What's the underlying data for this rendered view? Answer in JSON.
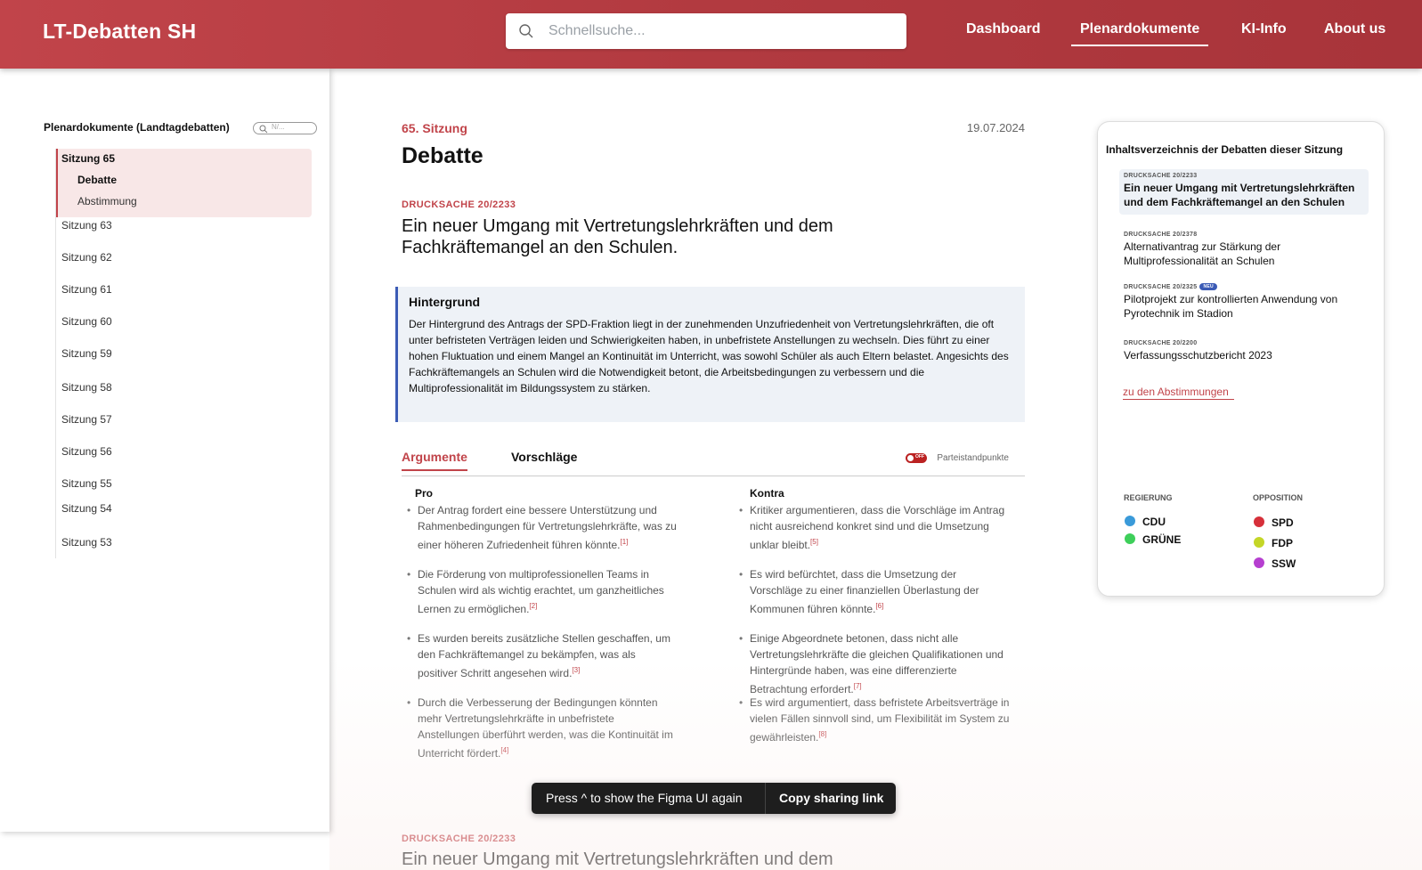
{
  "header": {
    "logo": "LT-Debatten SH",
    "search_placeholder": "Schnellsuche...",
    "nav": [
      "Dashboard",
      "Plenardokumente",
      "KI-Info",
      "About us"
    ],
    "active_nav": "Plenardokumente"
  },
  "sidebar": {
    "title": "Plenardokumente (Landtagdebatten)",
    "filter_placeholder": "N/...",
    "active_session": "Sitzung 65",
    "sub_items": [
      "Debatte",
      "Abstimmung"
    ],
    "sessions": [
      "Sitzung 63",
      "Sitzung 62",
      "Sitzung 61",
      "Sitzung 60",
      "Sitzung 59",
      "Sitzung 58",
      "Sitzung 57",
      "Sitzung 56",
      "Sitzung 55",
      "Sitzung 54",
      "Sitzung 53"
    ]
  },
  "main": {
    "sitzung": "65. Sitzung",
    "date": "19.07.2024",
    "title": "Debatte",
    "drucksache_label": "DRUCKSACHE 20/2233",
    "drucksache_title": "Ein neuer Umgang mit Vertretungslehrkräften und dem Fachkräftemangel an den Schulen.",
    "background": {
      "heading": "Hintergrund",
      "text": "Der Hintergrund des Antrags der SPD-Fraktion liegt in der zunehmenden  Unzufriedenheit von Vertretungslehrkräften, die oft unter befristeten  Verträgen leiden und Schwierigkeiten haben, in unbefristete Anstellungen  zu wechseln. Dies führt zu einer hohen Fluktuation und einem Mangel an  Kontinuität im Unterricht, was sowohl Schüler als auch Eltern belastet.  Angesichts des Fachkräftemangels an Schulen wird die Notwendigkeit  betont, die Arbeitsbedingungen zu verbessern und die  Multiprofessionalität im Bildungssystem zu stärken."
    },
    "tabs": [
      "Argumente",
      "Vorschläge"
    ],
    "toggle_state": "OFF",
    "toggle_label": "Parteistandpunkte",
    "pro_heading": "Pro",
    "kontra_heading": "Kontra",
    "pro": [
      {
        "text": "Der Antrag fordert eine bessere Unterstützung und Rahmenbedingungen für  Vertretungslehrkräfte, was zu einer höheren Zufriedenheit führen könnte.",
        "ref": "[1]"
      },
      {
        "text": "Die Förderung von multiprofessionellen Teams in Schulen wird als wichtig erachtet, um ganzheitliches Lernen zu ermöglichen.",
        "ref": "[2]"
      },
      {
        "text": "Es wurden bereits zusätzliche Stellen geschaffen, um den  Fachkräftemangel zu bekämpfen, was als positiver Schritt angesehen wird.",
        "ref": "[3]"
      },
      {
        "text": "Durch die Verbesserung der Bedingungen könnten mehr  Vertretungslehrkräfte in unbefristete Anstellungen überführt werden, was  die Kontinuität im Unterricht fördert.",
        "ref": "[4]"
      }
    ],
    "kontra": [
      {
        "text": "Kritiker argumentieren, dass die Vorschläge im Antrag nicht ausreichend konkret sind und die Umsetzung unklar bleibt.",
        "ref": "[5]"
      },
      {
        "text": "Es wird befürchtet, dass die Umsetzung der Vorschläge zu einer finanziellen Überlastung der Kommunen führen könnte.",
        "ref": "[6]"
      },
      {
        "text": "Einige Abgeordnete betonen, dass nicht alle Vertretungslehrkräfte die  gleichen Qualifikationen und Hintergründe haben, was eine differenzierte Betrachtung erfordert.",
        "ref": "[7]"
      },
      {
        "text": "Es wird argumentiert, dass befristete Arbeitsverträge in vielen Fällen  sinnvoll sind, um Flexibilität im System zu gewährleisten.",
        "ref": "[8]"
      }
    ],
    "next_label": "DRUCKSACHE 20/2233",
    "next_title": "Ein neuer Umgang mit Vertretungslehrkräften und dem"
  },
  "toc": {
    "title": "Inhaltsverzeichnis der Debatten dieser Sitzung",
    "items": [
      {
        "ds": "DRUCKSACHE 20/2233",
        "title": "Ein neuer Umgang mit Vertretungslehrkräften und dem Fachkräftemangel an den Schulen",
        "badge": ""
      },
      {
        "ds": "DRUCKSACHE 20/2378",
        "title": "Alternativantrag zur Stärkung der Multiprofessionalität an Schulen",
        "badge": ""
      },
      {
        "ds": "DRUCKSACHE 20/2325",
        "title": "Pilotprojekt zur kontrollierten Anwendung von Pyrotechnik im Stadion",
        "badge": "NEU"
      },
      {
        "ds": "DRUCKSACHE 20/2200",
        "title": "Verfassungsschutzbericht 2023",
        "badge": ""
      }
    ],
    "link": "zu den Abstimmungen",
    "regierung_label": "REGIERUNG",
    "opposition_label": "OPPOSITION",
    "regierung": [
      {
        "name": "CDU",
        "color": "#3a9ad9"
      },
      {
        "name": "GRÜNE",
        "color": "#3ecf5a"
      }
    ],
    "opposition": [
      {
        "name": "SPD",
        "color": "#d6303a"
      },
      {
        "name": "FDP",
        "color": "#c4d627"
      },
      {
        "name": "SSW",
        "color": "#b63fd0"
      }
    ]
  },
  "toast": {
    "message": "Press ^ to show the Figma UI again",
    "action": "Copy sharing link"
  },
  "colors": {
    "brand": "#c1444a",
    "accent_blue": "#3b5bb5"
  }
}
